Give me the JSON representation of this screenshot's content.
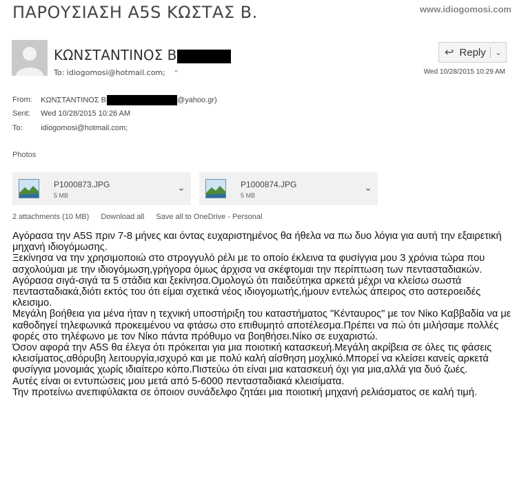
{
  "page": {
    "title": "ΠΑΡΟΥΣΙΑΣΗ Α5S ΚΩΣΤΑΣ Β.",
    "watermark": "www.idiogomosi.com"
  },
  "header": {
    "sender_name": "ΚΩΝΣΤΑΝΤΙΝΟΣ Β",
    "to_label": "To:",
    "to_value": "idiogomosi@hotmail.com;",
    "date": "Wed 10/28/2015 10:29 AM",
    "reply_label": "Reply",
    "icons": {
      "reply": "reply-arrow-icon",
      "reply_menu": "chevron-down-icon",
      "expand": "double-chevron-up-icon",
      "avatar": "person-silhouette-icon"
    }
  },
  "meta": {
    "from_label": "From:",
    "from_name": "ΚΩΝΣΤΑΝΤΙΝΟΣ Β",
    "from_email_suffix": "@yahoo.gr)",
    "sent_label": "Sent:",
    "sent_value": "Wed 10/28/2015 10:26 AM",
    "to_label": "To:",
    "to_value": "idiogomosi@hotmail.com;"
  },
  "attachments": {
    "section_label": "Photos",
    "items": [
      {
        "name": "P1000873.JPG",
        "size": "5 MB"
      },
      {
        "name": "P1000874.JPG",
        "size": "5 MB"
      }
    ],
    "summary": "2 attachments (10 MB)",
    "download_all": "Download all",
    "save_onedrive": "Save all to OneDrive - Personal"
  },
  "body": {
    "paragraphs": [
      "Αγόρασα την A5S πριν 7-8 μήνες και όντας ευχαριστημένος θα ήθελα να πω δυο λόγια για αυτή την εξαιρετική μηχανή ιδιογόμωσης.",
      "Ξεκίνησα να την χρησιμοποιώ στο στρογγυλό ρέλι με το οποίο έκλεινα τα φυσίγγια μου 3 χρόνια τώρα που ασχολούμαι με την ιδιογόμωση,γρήγορα όμως άρχισα να σκέφτομαι την περίπτωση των πεντασταδιακών.",
      "Αγόρασα σιγά-σιγά τα 5 στάδια και ξεκίνησα.Ομολογώ ότι παιδεύτηκα αρκετά μέχρι να κλείσω σωστά πεντασταδιακά,διότι εκτός του ότι είμαι σχετικά νέος ιδιογομωτής,ήμουν εντελώς άπειρος στο αστεροειδές κλεισιμο.",
      "Μεγάλη βοήθεια για μένα ήταν η τεχνική υποστήριξη του καταστήματος \"Κένταυρος\" με τον Νίκο Καββαδία να με καθοδηγεί τηλεφωνικά προκειμένου να φτάσω στο επιθυμητό αποτέλεσμα.Πρέπει να πώ ότι μιλήσαμε πολλές φορές στο τηλέφωνο με τον Νίκο πάντα πρόθυμο να βοηθήσει.Νίκο σε ευχαριστώ.",
      "Όσον αφορά την A5S θα έλεγα ότι πρόκειται για μια ποιοτική κατασκευή.Μεγάλη ακρίβεια σε όλες τις φάσεις κλεισίματος,αθόρυβη λειτουργία,ισχυρό και με πολύ καλή αίσθηση μοχλικό.Μπορεί να κλείσει κανείς αρκετά φυσίγγια μονομιάς χωρίς ιδιαίτερο κόπο.Πιστεύω ότι είναι μια κατασκευή όχι για μια,αλλά για δυό ζωές.",
      "Αυτές είναι οι εντυπώσεις μου μετά από 5-6000 πεντασταδιακά κλεισίματα.",
      "Την προτείνω ανεπιφύλακτα σε όποιον συνάδελφο ζητάει μια ποιοτική μηχανή ρελιάσματος σε καλή τιμή."
    ]
  }
}
